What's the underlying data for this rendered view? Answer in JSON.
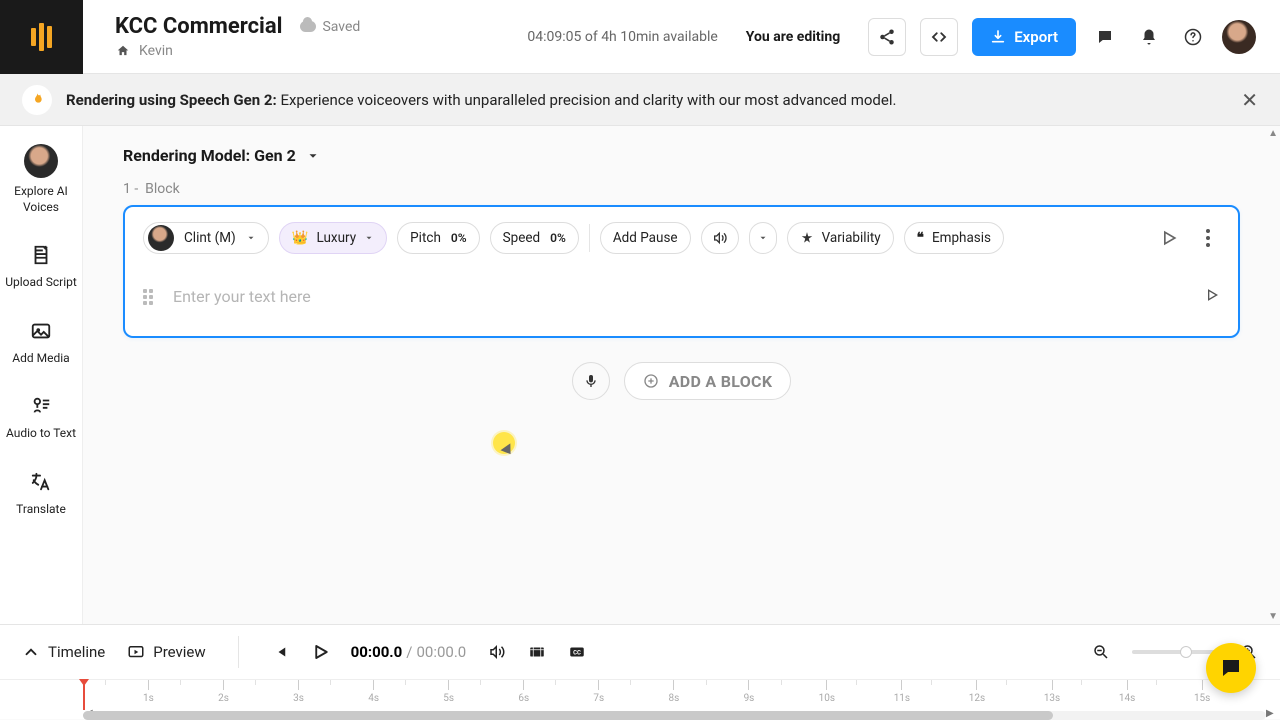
{
  "header": {
    "project_title": "KCC Commercial",
    "saved_label": "Saved",
    "breadcrumb_owner": "Kevin",
    "time_available": "04:09:05 of 4h 10min available",
    "editing_badge": "You are editing",
    "export_label": "Export"
  },
  "notice": {
    "bold": "Rendering using Speech Gen 2:",
    "rest": " Experience voiceovers with unparalleled precision and clarity with our most advanced model."
  },
  "sidebar": {
    "items": [
      {
        "label": "Explore AI Voices"
      },
      {
        "label": "Upload Script"
      },
      {
        "label": "Add Media"
      },
      {
        "label": "Audio to Text"
      },
      {
        "label": "Translate"
      }
    ]
  },
  "main": {
    "model_label": "Rendering Model: Gen 2",
    "block_index": "1 -",
    "block_word": "Block",
    "voice_name": "Clint (M)",
    "luxury_label": "Luxury",
    "pitch_label": "Pitch",
    "pitch_value": "0%",
    "speed_label": "Speed",
    "speed_value": "0%",
    "add_pause": "Add Pause",
    "variability": "Variability",
    "emphasis": "Emphasis",
    "text_placeholder": "Enter your text here",
    "add_block": "ADD A BLOCK"
  },
  "bottom": {
    "timeline_label": "Timeline",
    "preview_label": "Preview",
    "time_current": "00:00.0",
    "time_total": "00:00.0",
    "ticks": [
      "1s",
      "2s",
      "3s",
      "4s",
      "5s",
      "6s",
      "7s",
      "8s",
      "9s",
      "10s",
      "11s",
      "12s",
      "13s",
      "14s",
      "15s"
    ]
  }
}
